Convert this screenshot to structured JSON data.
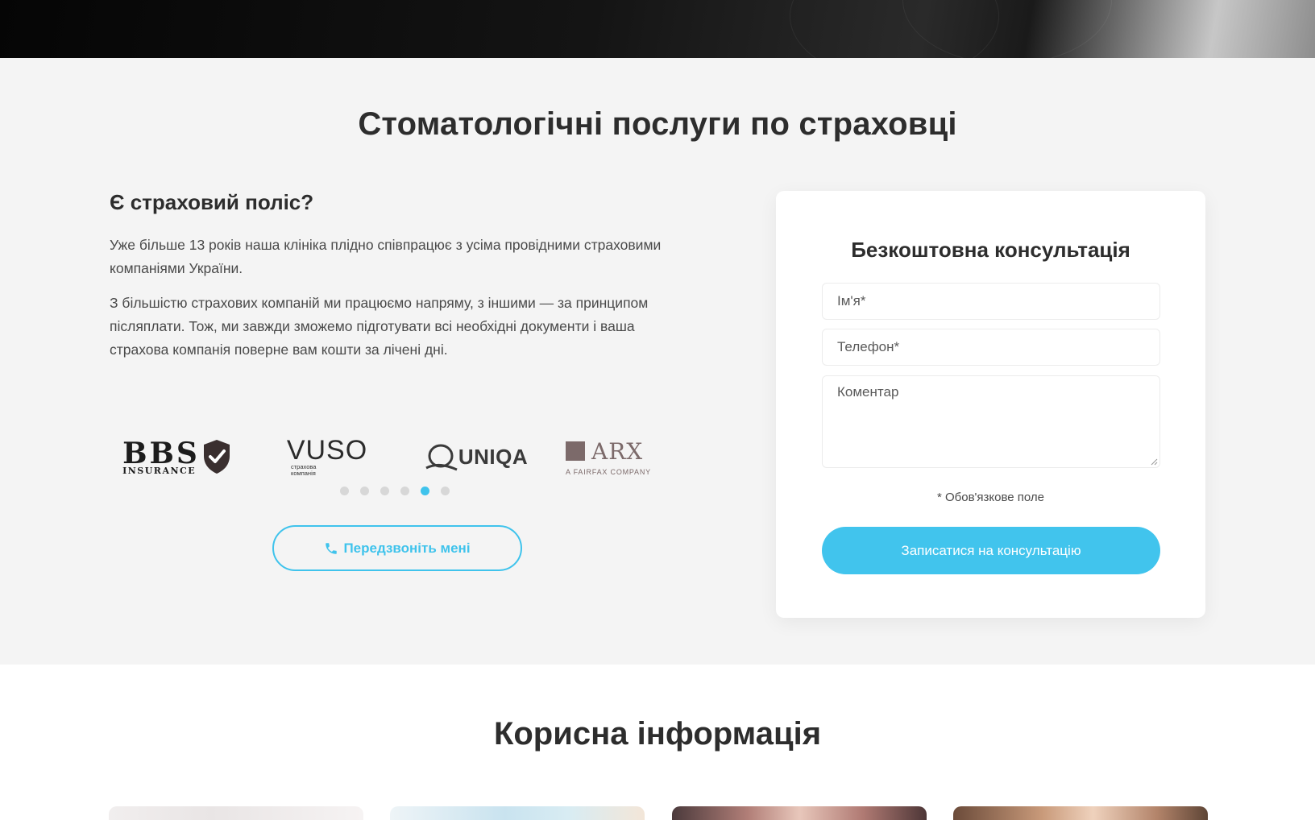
{
  "insurance_section": {
    "title": "Стоматологічні послуги по страховці",
    "subtitle": "Є страховий поліс?",
    "paragraph1": "Уже більше 13 років наша клініка плідно співпрацює з усіма провідними страховими компаніями України.",
    "paragraph2": "З більшістю страхових компаній ми працюємо напряму, з іншими — за принципом післяплати. Тож, ми завжди зможемо підготувати всі необхідні документи і ваша страхова компанія поверне вам кошти за лічені дні.",
    "logos": {
      "bbs_main": "BBS",
      "bbs_sub": "INSURANCE",
      "vuso_main": "VUSO",
      "vuso_sub": "страхова компанія",
      "uniqa_main": "UNIQA",
      "arx_main": "ARX",
      "arx_sub": "A FAIRFAX COMPANY"
    },
    "carousel": {
      "total_dots": 6,
      "active_index": 4
    },
    "callback_button": "Передзвоніть мені",
    "accent_color": "#3fc3ec"
  },
  "consultation_form": {
    "title": "Безкоштовна консультація",
    "name_placeholder": "Ім'я*",
    "phone_placeholder": "Телефон*",
    "comment_placeholder": "Коментар",
    "required_note": "* Обов'язкове поле",
    "submit_label": "Записатися на консультацію"
  },
  "useful_section": {
    "title": "Корисна інформація"
  }
}
